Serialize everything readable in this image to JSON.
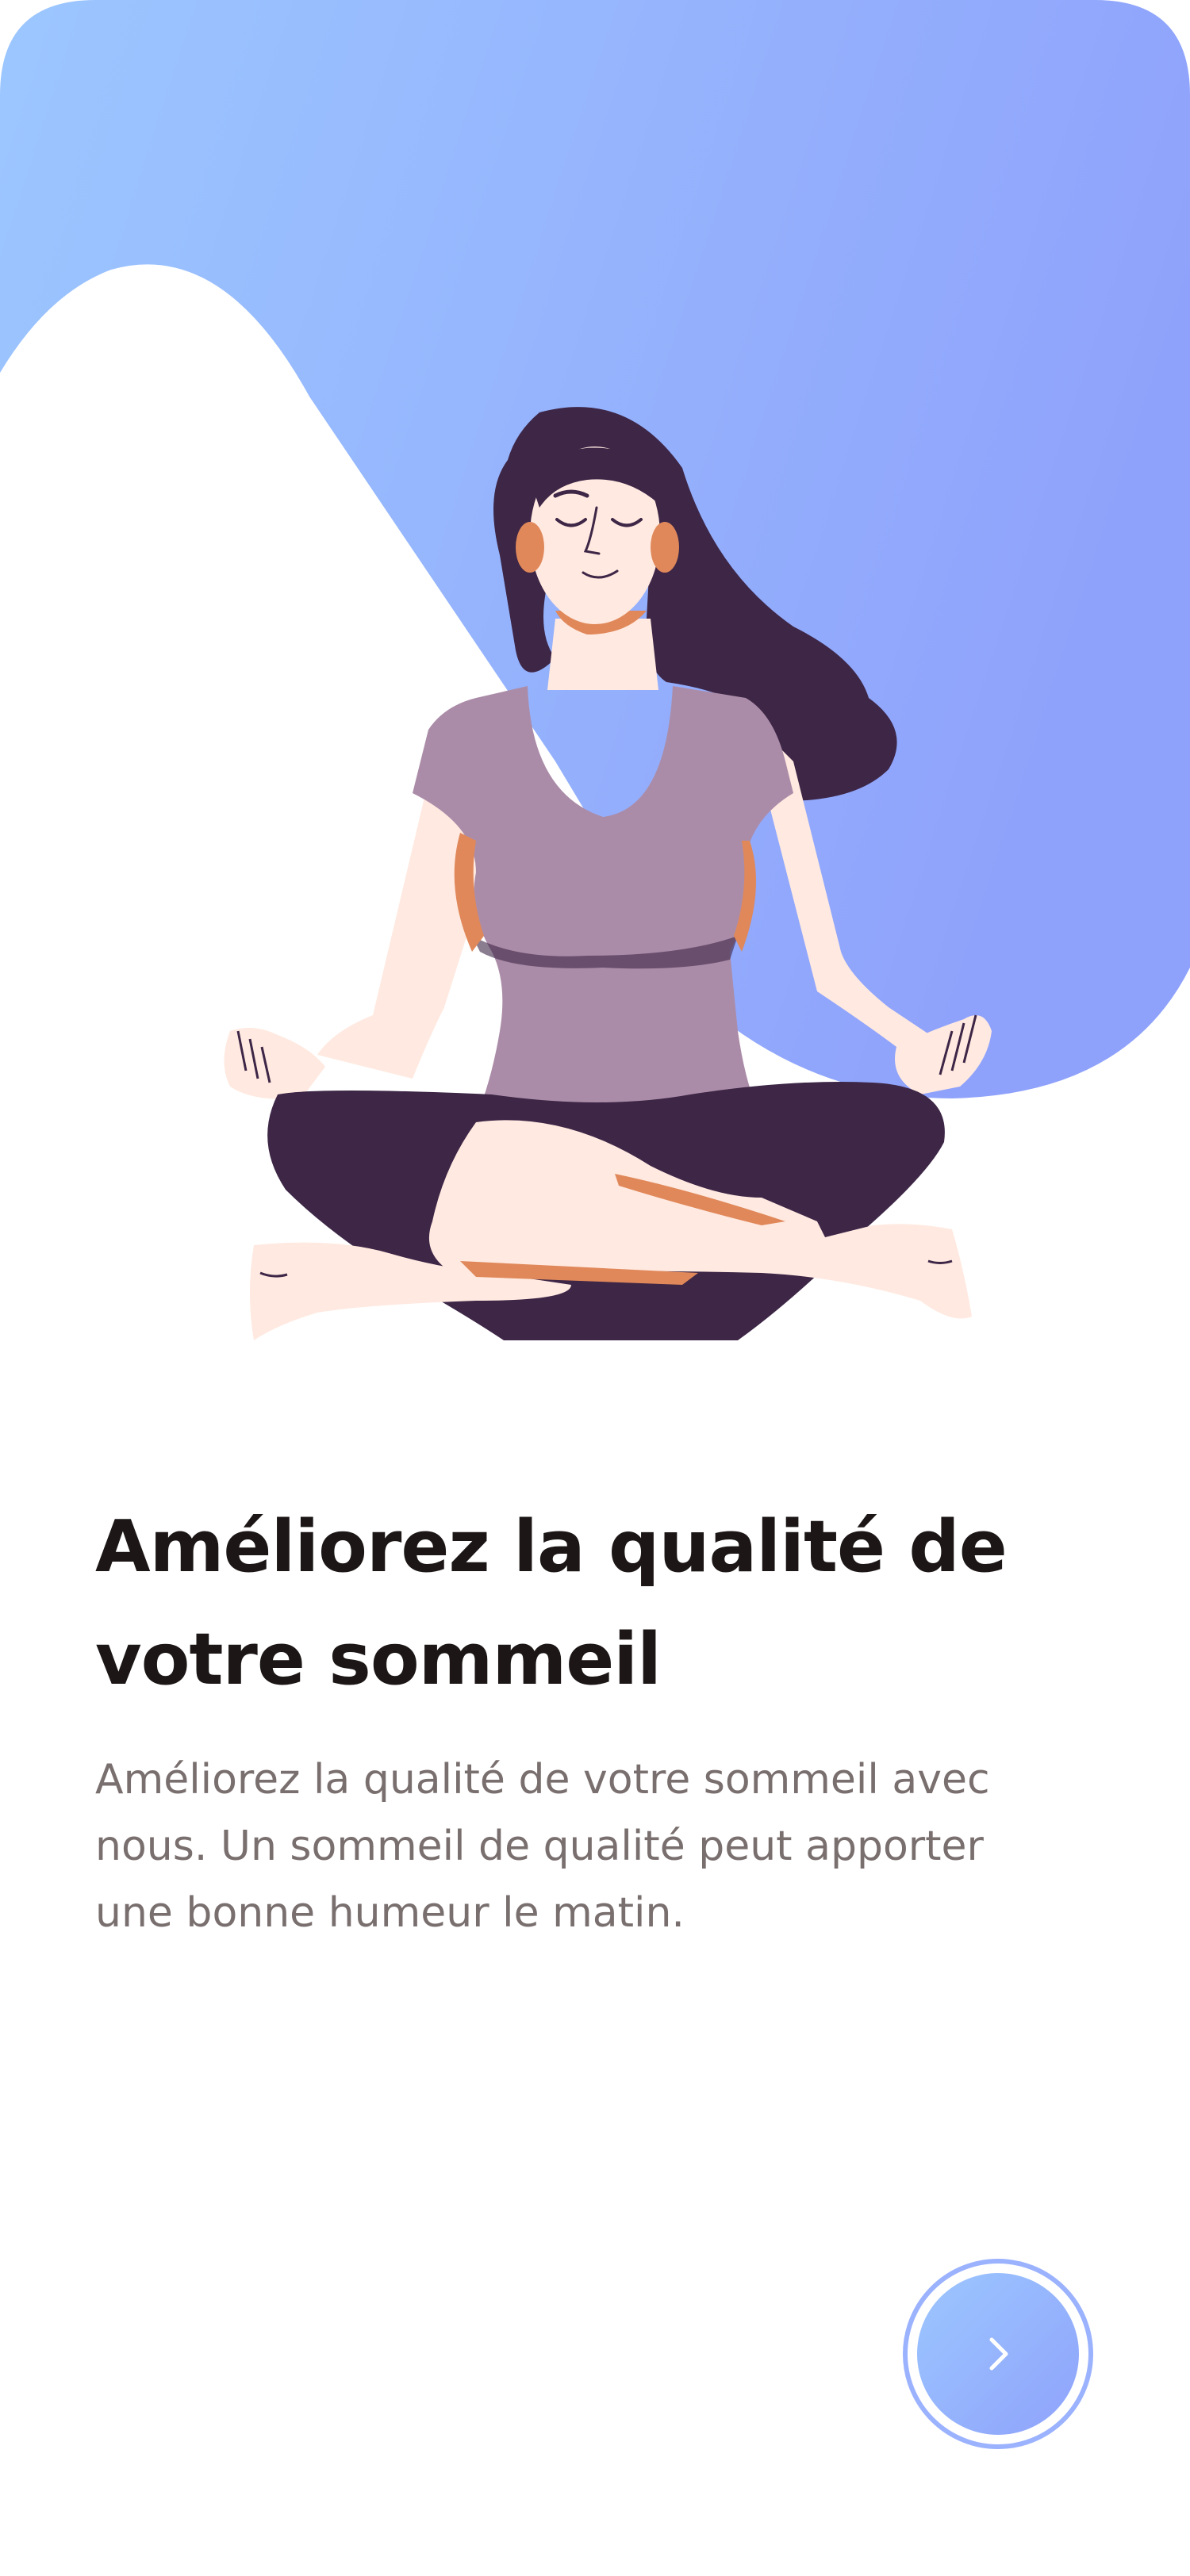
{
  "onboarding": {
    "title": "Améliorez la qualité de votre sommeil",
    "description": "Améliorez la qualité de votre sommeil avec nous. Un sommeil de qualité peut apporter une bonne humeur le matin."
  },
  "illustration": {
    "subject": "woman-meditating-lotus-pose"
  },
  "next_button": {
    "icon": "chevron-right-icon"
  },
  "colors": {
    "gradient_start": "#9cc7ff",
    "gradient_end": "#8fa2fb",
    "title": "#1c1616",
    "text": "#7a6f6f",
    "hair": "#3d2646",
    "shirt": "#ab8ca8",
    "skin": "#ffe9e0",
    "accent": "#e0885a"
  }
}
